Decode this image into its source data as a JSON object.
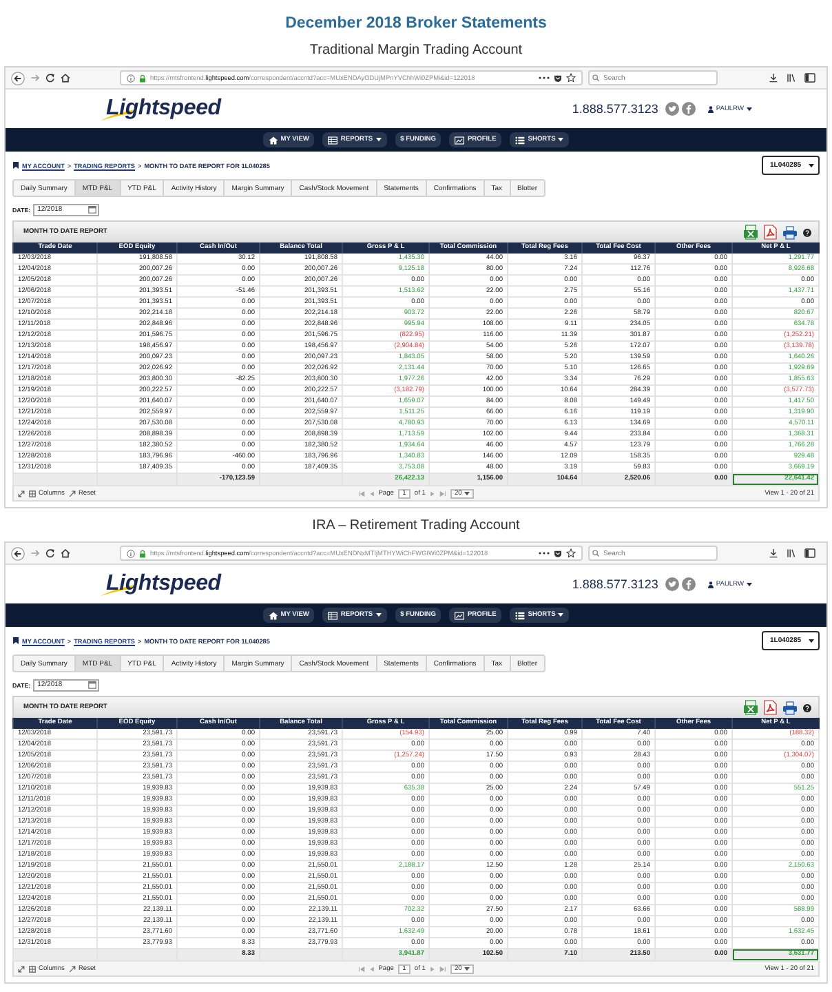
{
  "title": "December 2018 Broker Statements",
  "accounts": [
    {
      "heading": "Traditional Margin Trading Account",
      "browser": {
        "url": "https://mtsfrontend.**lightspeed.com**/correspondent/accntd?acc=MUxENDAyODUjMPnYVChhWi0ZPMi&id=122018",
        "search": {
          "placeholder": "Search"
        }
      },
      "site": {
        "logo": "Lightspeed",
        "phone": "1.888.577.3123",
        "user": "PAULRW"
      },
      "nav": [
        {
          "label": "MY VIEW",
          "kind": "home",
          "menu": false
        },
        {
          "label": "REPORTS",
          "kind": "table",
          "menu": true
        },
        {
          "label": "$ FUNDING",
          "kind": "text",
          "menu": false
        },
        {
          "label": "PROFILE",
          "kind": "chart",
          "menu": false
        },
        {
          "label": "SHORTS",
          "kind": "list",
          "menu": true
        }
      ],
      "breadcrumb": [
        {
          "label": "MY ACCOUNT",
          "kind": "link"
        },
        {
          "label": ">",
          "kind": "separator"
        },
        {
          "label": "TRADING REPORTS",
          "kind": "link"
        },
        {
          "label": ">",
          "kind": "separator"
        },
        {
          "label": "MONTH TO DATE REPORT FOR 1L040285",
          "kind": "current"
        }
      ],
      "account": "1L040285",
      "tabs": [
        {
          "label": "Daily Summary",
          "selected": false
        },
        {
          "label": "MTD P&L",
          "selected": true
        },
        {
          "label": "YTD P&L",
          "selected": false
        },
        {
          "label": "Activity History",
          "selected": false
        },
        {
          "label": "Margin Summary",
          "selected": false
        },
        {
          "label": "Cash/Stock Movement",
          "selected": false
        },
        {
          "label": "Statements",
          "selected": false
        },
        {
          "label": "Confirmations",
          "selected": false
        },
        {
          "label": "Tax",
          "selected": false
        },
        {
          "label": "Blotter",
          "selected": false
        }
      ],
      "date": {
        "label": "DATE:",
        "value": "12/2018"
      },
      "report": {
        "title": "MONTH TO DATE REPORT",
        "columns": [
          "Trade Date",
          "EOD Equity",
          "Cash In/Out",
          "Balance Total",
          "Gross P & L",
          "Total Commission",
          "Total Reg Fees",
          "Total Fee Cost",
          "Other Fees",
          "Net P & L"
        ],
        "rows": [
          [
            "12/03/2018",
            "191,808.58",
            "30.12",
            "191,808.58",
            {
              "text": "1,435.30",
              "negative": false
            },
            "44.00",
            "3.16",
            "96.37",
            "0.00",
            {
              "text": "1,291.77",
              "negative": false
            }
          ],
          [
            "12/04/2018",
            "200,007.26",
            "0.00",
            "200,007.26",
            {
              "text": "9,125.18",
              "negative": false
            },
            "80.00",
            "7.24",
            "112.76",
            "0.00",
            {
              "text": "8,926.68",
              "negative": false
            }
          ],
          [
            "12/05/2018",
            "200,007.26",
            "0.00",
            "200,007.26",
            "0.00",
            "0.00",
            "0.00",
            "0.00",
            "0.00",
            "0.00"
          ],
          [
            "12/06/2018",
            "201,393.51",
            "-51.46",
            "201,393.51",
            {
              "text": "1,513.62",
              "negative": false
            },
            "22.00",
            "2.75",
            "55.16",
            "0.00",
            {
              "text": "1,437.71",
              "negative": false
            }
          ],
          [
            "12/07/2018",
            "201,393.51",
            "0.00",
            "201,393.51",
            "0.00",
            "0.00",
            "0.00",
            "0.00",
            "0.00",
            "0.00"
          ],
          [
            "12/10/2018",
            "202,214.18",
            "0.00",
            "202,214.18",
            {
              "text": "903.72",
              "negative": false
            },
            "22.00",
            "2.26",
            "58.79",
            "0.00",
            {
              "text": "820.67",
              "negative": false
            }
          ],
          [
            "12/11/2018",
            "202,848.96",
            "0.00",
            "202,848.96",
            {
              "text": "995.94",
              "negative": false
            },
            "108.00",
            "9.11",
            "234.05",
            "0.00",
            {
              "text": "634.78",
              "negative": false
            }
          ],
          [
            "12/12/2018",
            "201,596.75",
            "0.00",
            "201,596.75",
            {
              "text": "(822.95)",
              "negative": true
            },
            "116.00",
            "11.39",
            "301.87",
            "0.00",
            {
              "text": "(1,252.21)",
              "negative": true
            }
          ],
          [
            "12/13/2018",
            "198,456.97",
            "0.00",
            "198,456.97",
            {
              "text": "(2,904.84)",
              "negative": true
            },
            "54.00",
            "5.26",
            "172.07",
            "0.00",
            {
              "text": "(3,139.78)",
              "negative": true
            }
          ],
          [
            "12/14/2018",
            "200,097.23",
            "0.00",
            "200,097.23",
            {
              "text": "1,843.05",
              "negative": false
            },
            "58.00",
            "5.20",
            "139.59",
            "0.00",
            {
              "text": "1,640.26",
              "negative": false
            }
          ],
          [
            "12/17/2018",
            "202,026.92",
            "0.00",
            "202,026.92",
            {
              "text": "2,131.44",
              "negative": false
            },
            "70.00",
            "5.10",
            "126.65",
            "0.00",
            {
              "text": "1,929.69",
              "negative": false
            }
          ],
          [
            "12/18/2018",
            "203,800.30",
            "-82.25",
            "203,800.30",
            {
              "text": "1,977.26",
              "negative": false
            },
            "42.00",
            "3.34",
            "76.29",
            "0.00",
            {
              "text": "1,855.63",
              "negative": false
            }
          ],
          [
            "12/19/2018",
            "200,222.57",
            "0.00",
            "200,222.57",
            {
              "text": "(3,182.79)",
              "negative": true
            },
            "100.00",
            "10.64",
            "284.39",
            "0.00",
            {
              "text": "(3,577.73)",
              "negative": true
            }
          ],
          [
            "12/20/2018",
            "201,640.07",
            "0.00",
            "201,640.07",
            {
              "text": "1,659.07",
              "negative": false
            },
            "84.00",
            "8.08",
            "149.49",
            "0.00",
            {
              "text": "1,417.50",
              "negative": false
            }
          ],
          [
            "12/21/2018",
            "202,559.97",
            "0.00",
            "202,559.97",
            {
              "text": "1,511.25",
              "negative": false
            },
            "66.00",
            "6.16",
            "119.19",
            "0.00",
            {
              "text": "1,319.90",
              "negative": false
            }
          ],
          [
            "12/24/2018",
            "207,530.08",
            "0.00",
            "207,530.08",
            {
              "text": "4,780.93",
              "negative": false
            },
            "70.00",
            "6.13",
            "134.69",
            "0.00",
            {
              "text": "4,570.11",
              "negative": false
            }
          ],
          [
            "12/26/2018",
            "208,898.39",
            "0.00",
            "208,898.39",
            {
              "text": "1,713.59",
              "negative": false
            },
            "102.00",
            "9.44",
            "233.84",
            "0.00",
            {
              "text": "1,368.31",
              "negative": false
            }
          ],
          [
            "12/27/2018",
            "182,380.52",
            "0.00",
            "182,380.52",
            {
              "text": "1,934.64",
              "negative": false
            },
            "46.00",
            "4.57",
            "123.79",
            "0.00",
            {
              "text": "1,766.28",
              "negative": false
            }
          ],
          [
            "12/28/2018",
            "183,796.96",
            "-460.00",
            "183,796.96",
            {
              "text": "1,340.83",
              "negative": false
            },
            "146.00",
            "12.09",
            "158.35",
            "0.00",
            {
              "text": "929.48",
              "negative": false
            }
          ],
          [
            "12/31/2018",
            "187,409.35",
            "0.00",
            "187,409.35",
            {
              "text": "3,753.08",
              "negative": false
            },
            "48.00",
            "3.19",
            "59.83",
            "0.00",
            {
              "text": "3,669.19",
              "negative": false
            }
          ]
        ],
        "totals": {
          "cash_in_out": "-170,123.59",
          "gross_pl": {
            "text": "26,422.13",
            "negative": false
          },
          "total_commission": "1,156.00",
          "total_reg_fees": "104.64",
          "total_fee_cost": "2,520.06",
          "other_fees": "0.00",
          "net_pl": {
            "text": "22,641.42",
            "negative": false,
            "boxed": true
          }
        },
        "footer": {
          "columns_button": "Columns",
          "reset_button": "Reset",
          "page_label": "Page",
          "page": "1",
          "page_total": "of 1",
          "page_size": "20",
          "view_text": "View 1 - 20 of 21"
        }
      }
    },
    {
      "heading": "IRA – Retirement Trading Account",
      "browser": {
        "url": "https://mtsfrontend.**lightspeed.com**/correspondent/accntd?acc=MUxENDNxMTIjMTHYWiChFWGIWi0ZPM&id=122018",
        "search": {
          "placeholder": "Search"
        }
      },
      "site": {
        "logo": "Lightspeed",
        "phone": "1.888.577.3123",
        "user": "PAULRW"
      },
      "nav": [
        {
          "label": "MY VIEW",
          "kind": "home",
          "menu": false
        },
        {
          "label": "REPORTS",
          "kind": "table",
          "menu": true
        },
        {
          "label": "$ FUNDING",
          "kind": "text",
          "menu": false
        },
        {
          "label": "PROFILE",
          "kind": "chart",
          "menu": false
        },
        {
          "label": "SHORTS",
          "kind": "list",
          "menu": true
        }
      ],
      "breadcrumb": [
        {
          "label": "MY ACCOUNT",
          "kind": "link"
        },
        {
          "label": ">",
          "kind": "separator"
        },
        {
          "label": "TRADING REPORTS",
          "kind": "link"
        },
        {
          "label": ">",
          "kind": "separator"
        },
        {
          "label": "MONTH TO DATE REPORT FOR 1L040285",
          "kind": "current"
        }
      ],
      "account": "1L040285",
      "tabs": [
        {
          "label": "Daily Summary",
          "selected": false
        },
        {
          "label": "MTD P&L",
          "selected": true
        },
        {
          "label": "YTD P&L",
          "selected": false
        },
        {
          "label": "Activity History",
          "selected": false
        },
        {
          "label": "Margin Summary",
          "selected": false
        },
        {
          "label": "Cash/Stock Movement",
          "selected": false
        },
        {
          "label": "Statements",
          "selected": false
        },
        {
          "label": "Confirmations",
          "selected": false
        },
        {
          "label": "Tax",
          "selected": false
        },
        {
          "label": "Blotter",
          "selected": false
        }
      ],
      "date": {
        "label": "DATE:",
        "value": "12/2018"
      },
      "report": {
        "title": "MONTH TO DATE REPORT",
        "columns": [
          "Trade Date",
          "EOD Equity",
          "Cash In/Out",
          "Balance Total",
          "Gross P & L",
          "Total Commission",
          "Total Reg Fees",
          "Total Fee Cost",
          "Other Fees",
          "Net P & L"
        ],
        "rows": [
          [
            "12/03/2018",
            "23,591.73",
            "0.00",
            "23,591.73",
            {
              "text": "(154.93)",
              "negative": true
            },
            "25.00",
            "0.99",
            "7.40",
            "0.00",
            {
              "text": "(188.32)",
              "negative": true
            }
          ],
          [
            "12/04/2018",
            "23,591.73",
            "0.00",
            "23,591.73",
            "0.00",
            "0.00",
            "0.00",
            "0.00",
            "0.00",
            "0.00"
          ],
          [
            "12/05/2018",
            "23,591.73",
            "0.00",
            "23,591.73",
            {
              "text": "(1,257.24)",
              "negative": true
            },
            "17.50",
            "0.93",
            "28.43",
            "0.00",
            {
              "text": "(1,304.07)",
              "negative": true
            }
          ],
          [
            "12/06/2018",
            "23,591.73",
            "0.00",
            "23,591.73",
            "0.00",
            "0.00",
            "0.00",
            "0.00",
            "0.00",
            "0.00"
          ],
          [
            "12/07/2018",
            "23,591.73",
            "0.00",
            "23,591.73",
            "0.00",
            "0.00",
            "0.00",
            "0.00",
            "0.00",
            "0.00"
          ],
          [
            "12/10/2018",
            "19,939.83",
            "0.00",
            "19,939.83",
            {
              "text": "635.38",
              "negative": false
            },
            "25.00",
            "2.24",
            "57.49",
            "0.00",
            {
              "text": "551.25",
              "negative": false
            }
          ],
          [
            "12/11/2018",
            "19,939.83",
            "0.00",
            "19,939.83",
            "0.00",
            "0.00",
            "0.00",
            "0.00",
            "0.00",
            "0.00"
          ],
          [
            "12/12/2018",
            "19,939.83",
            "0.00",
            "19,939.83",
            "0.00",
            "0.00",
            "0.00",
            "0.00",
            "0.00",
            "0.00"
          ],
          [
            "12/13/2018",
            "19,939.83",
            "0.00",
            "19,939.83",
            "0.00",
            "0.00",
            "0.00",
            "0.00",
            "0.00",
            "0.00"
          ],
          [
            "12/14/2018",
            "19,939.83",
            "0.00",
            "19,939.83",
            "0.00",
            "0.00",
            "0.00",
            "0.00",
            "0.00",
            "0.00"
          ],
          [
            "12/17/2018",
            "19,939.83",
            "0.00",
            "19,939.83",
            "0.00",
            "0.00",
            "0.00",
            "0.00",
            "0.00",
            "0.00"
          ],
          [
            "12/18/2018",
            "19,939.83",
            "0.00",
            "19,939.83",
            "0.00",
            "0.00",
            "0.00",
            "0.00",
            "0.00",
            "0.00"
          ],
          [
            "12/19/2018",
            "21,550.01",
            "0.00",
            "21,550.01",
            {
              "text": "2,188.17",
              "negative": false
            },
            "12.50",
            "1.28",
            "25.14",
            "0.00",
            {
              "text": "2,150.63",
              "negative": false
            }
          ],
          [
            "12/20/2018",
            "21,550.01",
            "0.00",
            "21,550.01",
            "0.00",
            "0.00",
            "0.00",
            "0.00",
            "0.00",
            "0.00"
          ],
          [
            "12/21/2018",
            "21,550.01",
            "0.00",
            "21,550.01",
            "0.00",
            "0.00",
            "0.00",
            "0.00",
            "0.00",
            "0.00"
          ],
          [
            "12/24/2018",
            "21,550.01",
            "0.00",
            "21,550.01",
            "0.00",
            "0.00",
            "0.00",
            "0.00",
            "0.00",
            "0.00"
          ],
          [
            "12/26/2018",
            "22,139.11",
            "0.00",
            "22,139.11",
            {
              "text": "702.32",
              "negative": false
            },
            "27.50",
            "2.17",
            "63.66",
            "0.00",
            {
              "text": "588.99",
              "negative": false
            }
          ],
          [
            "12/27/2018",
            "22,139.11",
            "0.00",
            "22,139.11",
            "0.00",
            "0.00",
            "0.00",
            "0.00",
            "0.00",
            "0.00"
          ],
          [
            "12/28/2018",
            "23,771.60",
            "0.00",
            "23,771.60",
            {
              "text": "1,632.49",
              "negative": false
            },
            "20.00",
            "0.78",
            "18.61",
            "0.00",
            {
              "text": "1,632.45",
              "negative": false
            }
          ],
          [
            "12/31/2018",
            "23,779.93",
            "8.33",
            "23,779.93",
            "0.00",
            "0.00",
            "0.00",
            "0.00",
            "0.00",
            "0.00"
          ]
        ],
        "totals": {
          "cash_in_out": "8.33",
          "gross_pl": {
            "text": "3,941.87",
            "negative": false
          },
          "total_commission": "102.50",
          "total_reg_fees": "7.10",
          "total_fee_cost": "213.50",
          "other_fees": "0.00",
          "net_pl": {
            "text": "3,631.77",
            "negative": false,
            "boxed": true
          }
        },
        "footer": {
          "columns_button": "Columns",
          "reset_button": "Reset",
          "page_label": "Page",
          "page": "1",
          "page_total": "of 1",
          "page_size": "20",
          "view_text": "View 1 - 20 of 21"
        }
      }
    }
  ]
}
